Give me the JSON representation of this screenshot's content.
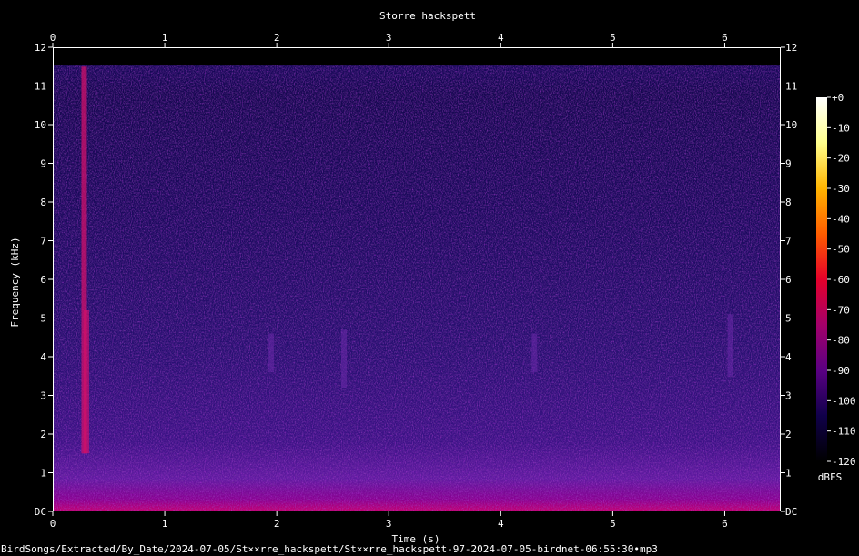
{
  "chart_data": {
    "type": "heatmap",
    "title": "Storre hackspett",
    "xlabel": "Time (s)",
    "ylabel": "Frequency (kHz)",
    "xlim": [
      0,
      6.5
    ],
    "ylim": [
      0,
      12
    ],
    "x_ticks": [
      "0",
      "1",
      "2",
      "3",
      "4",
      "5",
      "6"
    ],
    "y_ticks": [
      "DC",
      "1",
      "2",
      "3",
      "4",
      "5",
      "6",
      "7",
      "8",
      "9",
      "10",
      "11",
      "12"
    ],
    "colorbar": {
      "label": "dBFS",
      "range": [
        -120,
        0
      ],
      "ticks": [
        "+0",
        "-10",
        "-20",
        "-30",
        "-40",
        "-50",
        "-60",
        "-70",
        "-80",
        "-90",
        "-100",
        "-110",
        "-120"
      ],
      "colors": [
        "#000000",
        "#10004a",
        "#5a0083",
        "#a3006a",
        "#e4002a",
        "#ff5d00",
        "#ffb400",
        "#ffff8c",
        "#ffffff"
      ]
    },
    "events": [
      {
        "time": 0.28,
        "freq_low": 1.5,
        "freq_high": 11.5,
        "level": -60
      },
      {
        "time": 0.3,
        "freq_low": 1.5,
        "freq_high": 5.2,
        "level": -65
      },
      {
        "time": 1.95,
        "freq_low": 3.6,
        "freq_high": 4.6,
        "level": -85
      },
      {
        "time": 2.6,
        "freq_low": 3.2,
        "freq_high": 4.7,
        "level": -85
      },
      {
        "time": 4.3,
        "freq_low": 3.6,
        "freq_high": 4.6,
        "level": -85
      },
      {
        "time": 6.05,
        "freq_low": 3.5,
        "freq_high": 5.1,
        "level": -85
      }
    ]
  },
  "footer": {
    "path": "BirdSongs/Extracted/By_Date/2024-07-05/St××rre_hackspett/St××rre_hackspett-97-2024-07-05-birdnet-06:55:30•mp3"
  }
}
